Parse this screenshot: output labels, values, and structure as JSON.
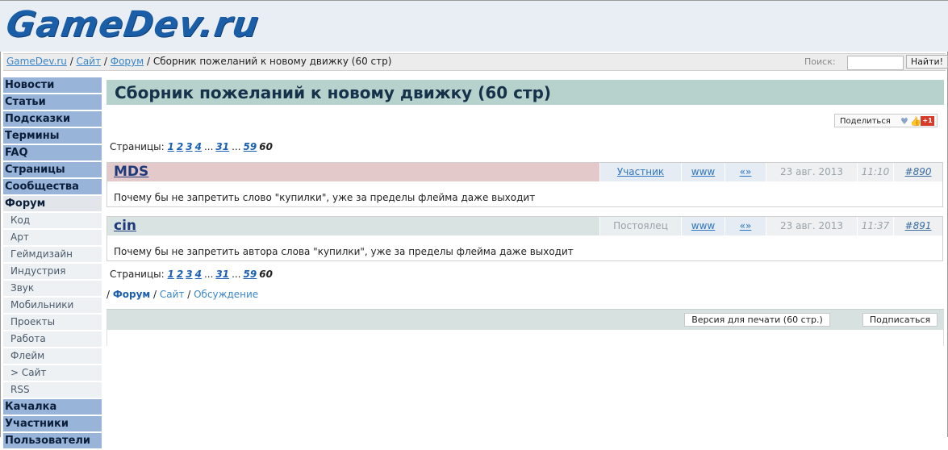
{
  "site": {
    "logo": "GameDev.ru"
  },
  "breadcrumb": {
    "home": "GameDev.ru",
    "sep": " / ",
    "site": "Сайт",
    "forum": "Форум",
    "current": "Сборник пожеланий к новому движку (60 стр)"
  },
  "search": {
    "label": "Поиск:",
    "value": "",
    "button": "Найти!"
  },
  "sidebar": {
    "items": [
      {
        "label": "Новости",
        "type": "main"
      },
      {
        "label": "Статьи",
        "type": "main"
      },
      {
        "label": "Подсказки",
        "type": "main"
      },
      {
        "label": "Термины",
        "type": "main"
      },
      {
        "label": "FAQ",
        "type": "main"
      },
      {
        "label": "Страницы",
        "type": "main"
      },
      {
        "label": "Сообщества",
        "type": "main"
      },
      {
        "label": "Форум",
        "type": "forum"
      },
      {
        "label": "Код",
        "type": "sub"
      },
      {
        "label": "Арт",
        "type": "sub"
      },
      {
        "label": "Геймдизайн",
        "type": "sub"
      },
      {
        "label": "Индустрия",
        "type": "sub"
      },
      {
        "label": "Звук",
        "type": "sub"
      },
      {
        "label": "Мобильники",
        "type": "sub"
      },
      {
        "label": "Проекты",
        "type": "sub"
      },
      {
        "label": "Работа",
        "type": "sub"
      },
      {
        "label": "Флейм",
        "type": "sub"
      },
      {
        "label": "> Сайт",
        "type": "sub"
      },
      {
        "label": "RSS",
        "type": "sub"
      },
      {
        "label": "Качалка",
        "type": "main"
      },
      {
        "label": "Участники",
        "type": "main"
      },
      {
        "label": "Пользователи",
        "type": "main"
      }
    ]
  },
  "page": {
    "title": "Сборник пожеланий к новому движку (60 стр)"
  },
  "share": {
    "label": "Поделиться",
    "plus": "+1"
  },
  "pager": {
    "label": "Страницы:",
    "pages": [
      "1",
      "2",
      "3",
      "4"
    ],
    "ellipsis": "...",
    "mid": "31",
    "prev": "59",
    "current": "60"
  },
  "posts": [
    {
      "author": "MDS",
      "role": "Участник",
      "www": "www",
      "quote": "«»",
      "date": "23 авг. 2013",
      "time": "11:10",
      "num": "#890",
      "text": "Почему бы не запретить слово \"купилки\", уже за пределы флейма даже выходит",
      "colors": {
        "head": "#e3c9c9",
        "role_bg": "#e5ecf3",
        "role_fg": "#2f75bf"
      }
    },
    {
      "author": "cin",
      "role": "Постоялец",
      "www": "www",
      "quote": "«»",
      "date": "23 авг. 2013",
      "time": "11:37",
      "num": "#891",
      "text": "Почему бы не запретить автора слова \"купилки\", уже за пределы флейма даже выходит",
      "colors": {
        "head": "#d9e4e2",
        "role_bg": "#e9eef1",
        "role_fg": "#9aa3aa"
      }
    }
  ],
  "footer_links": {
    "forum": "Форум",
    "site": "Сайт",
    "discussion": "Обсуждение"
  },
  "toolbar": {
    "print": "Версия для печати (60 стр.)",
    "subscribe": "Подписаться"
  }
}
